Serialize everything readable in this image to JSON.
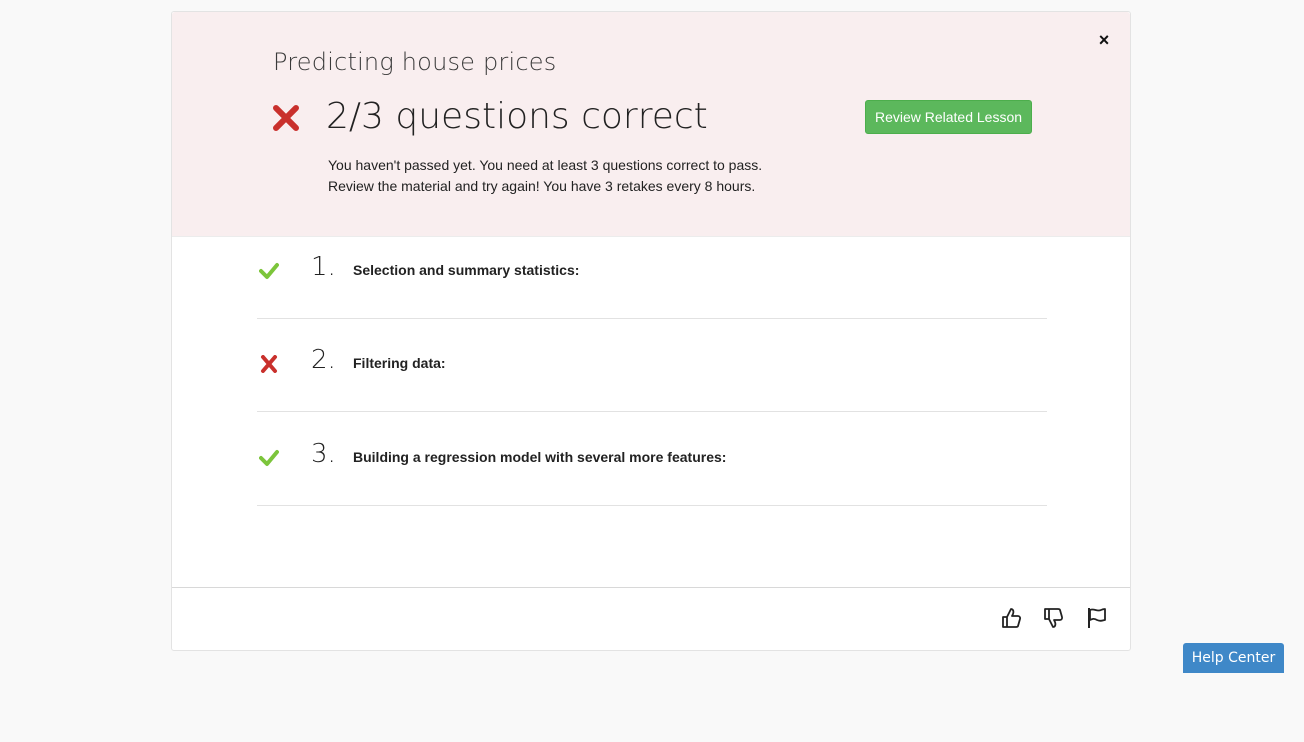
{
  "modal": {
    "close_label": "×",
    "title": "Predicting house prices",
    "score_text": "2/3 questions correct",
    "review_button": "Review Related Lesson",
    "message_line1": "You haven't passed yet. You need at least 3 questions correct to pass.",
    "message_line2": "Review the material and try again! You have 3 retakes every 8 hours."
  },
  "questions": [
    {
      "number": "1.",
      "text": "Selection and summary statistics:",
      "status": "correct"
    },
    {
      "number": "2.",
      "text": "Filtering data:",
      "status": "incorrect"
    },
    {
      "number": "3.",
      "text": "Building a regression model with several more features:",
      "status": "correct"
    }
  ],
  "footer": {
    "icons": [
      "thumbs-up-icon",
      "thumbs-down-icon",
      "flag-icon"
    ]
  },
  "help_center": {
    "label": "Help Center"
  },
  "colors": {
    "correct": "#7cc53b",
    "incorrect": "#c9302c",
    "review_button": "#5cb85c",
    "help_button": "#3f88c8",
    "header_bg": "#f9eeef"
  }
}
